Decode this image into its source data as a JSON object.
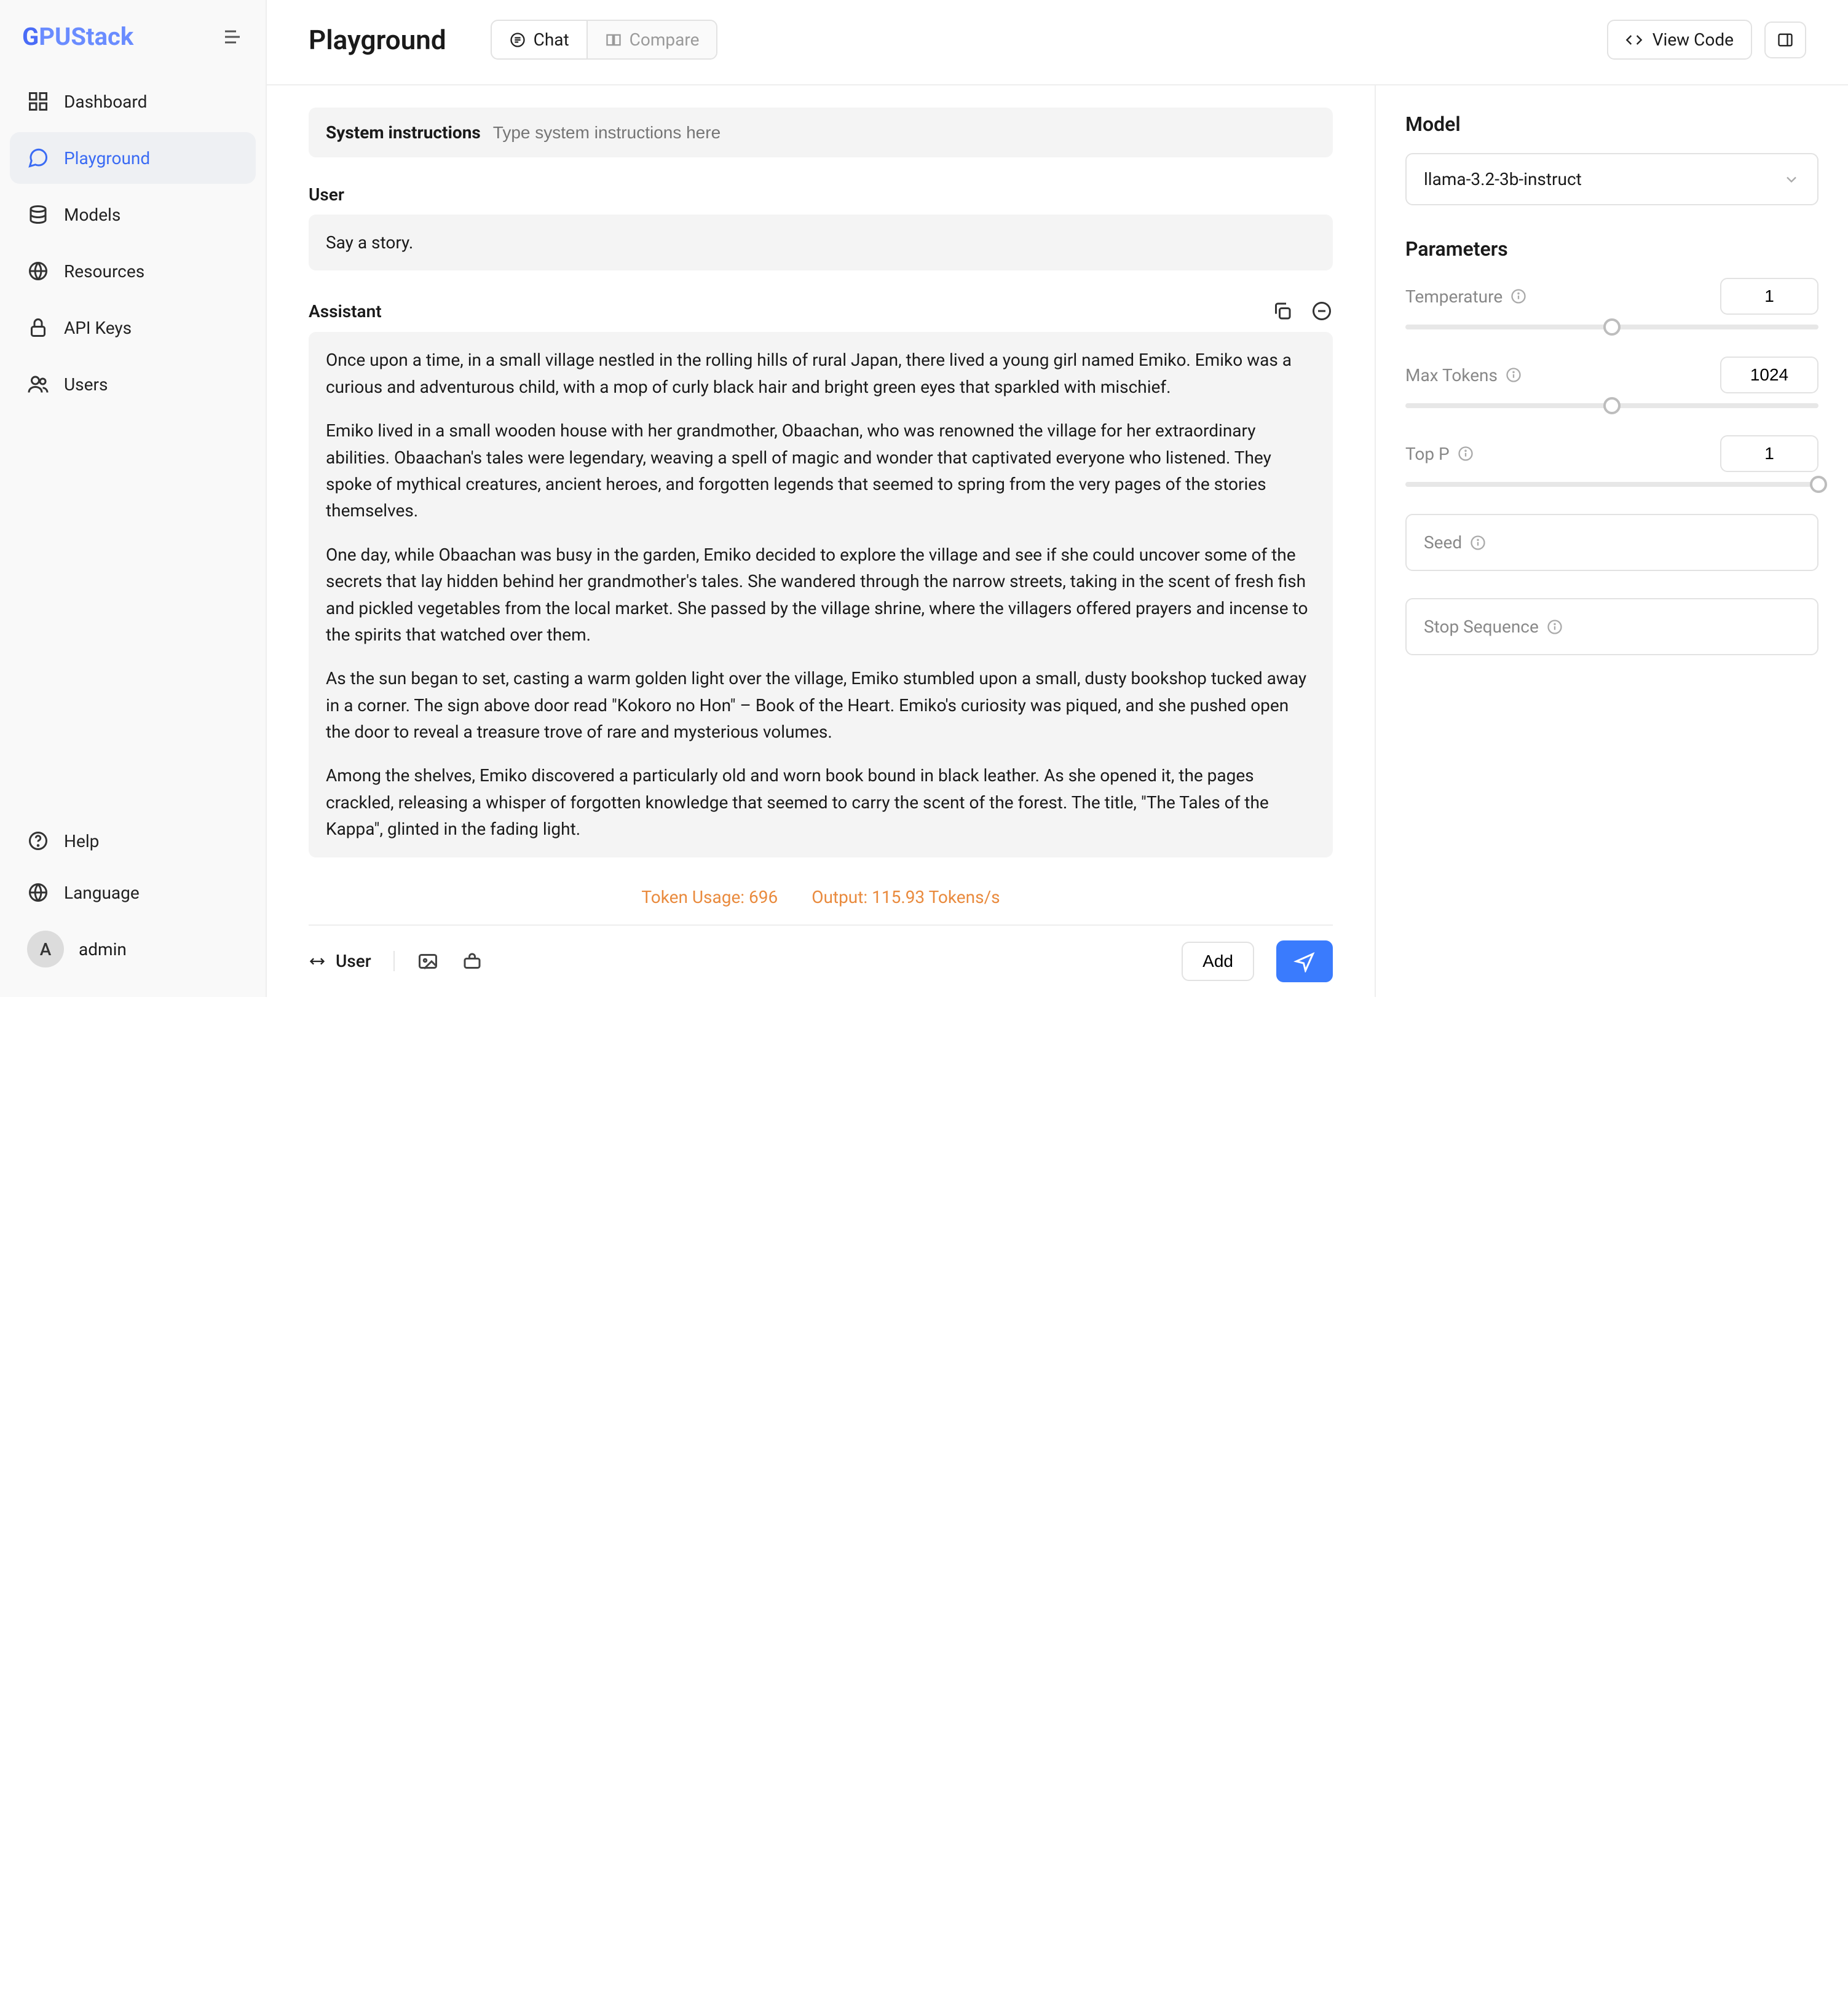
{
  "brand": {
    "g": "G",
    "rest": "PUStack"
  },
  "sidebar": {
    "items": [
      {
        "label": "Dashboard"
      },
      {
        "label": "Playground"
      },
      {
        "label": "Models"
      },
      {
        "label": "Resources"
      },
      {
        "label": "API Keys"
      },
      {
        "label": "Users"
      }
    ],
    "bottom": [
      {
        "label": "Help"
      },
      {
        "label": "Language"
      }
    ],
    "user": {
      "initial": "A",
      "name": "admin"
    }
  },
  "topbar": {
    "title": "Playground",
    "tab_chat": "Chat",
    "tab_compare": "Compare",
    "view_code": "View Code"
  },
  "system": {
    "label": "System instructions",
    "placeholder": "Type system instructions here"
  },
  "conversation": {
    "user_role": "User",
    "user_msg": "Say a story.",
    "assistant_role": "Assistant",
    "assistant_paragraphs": [
      "Once upon a time, in a small village nestled in the rolling hills of rural Japan, there lived a young girl named Emiko. Emiko was a curious and adventurous child, with a mop of curly black hair and bright green eyes that sparkled with mischief.",
      "Emiko lived in a small wooden house with her grandmother, Obaachan, who was renowned the village for her extraordinary abilities. Obaachan's tales were legendary, weaving a spell of magic and wonder that captivated everyone who listened. They spoke of mythical creatures, ancient heroes, and forgotten legends that seemed to spring from the very pages of the stories themselves.",
      "One day, while Obaachan was busy in the garden, Emiko decided to explore the village and see if she could uncover some of the secrets that lay hidden behind her grandmother's tales. She wandered through the narrow streets, taking in the scent of fresh fish and pickled vegetables from the local market. She passed by the village shrine, where the villagers offered prayers and incense to the spirits that watched over them.",
      "As the sun began to set, casting a warm golden light over the village, Emiko stumbled upon a small, dusty bookshop tucked away in a corner. The sign above door read \"Kokoro no Hon\" – Book of the Heart. Emiko's curiosity was piqued, and she pushed open the door to reveal a treasure trove of rare and mysterious volumes.",
      "Among the shelves, Emiko discovered a particularly old and worn book bound in black leather. As she opened it, the pages crackled, releasing a whisper of forgotten knowledge that seemed to carry the scent of the forest. The title, \"The Tales of the Kappa\", glinted in the fading light."
    ]
  },
  "stats": {
    "token_usage": "Token Usage: 696",
    "output": "Output: 115.93 Tokens/s"
  },
  "input_row": {
    "role": "User",
    "add": "Add"
  },
  "panel": {
    "model_section": "Model",
    "model_value": "llama-3.2-3b-instruct",
    "params_section": "Parameters",
    "temperature_label": "Temperature",
    "temperature_value": "1",
    "temperature_pct": 50,
    "max_tokens_label": "Max Tokens",
    "max_tokens_value": "1024",
    "max_tokens_pct": 50,
    "top_p_label": "Top P",
    "top_p_value": "1",
    "top_p_pct": 100,
    "seed_label": "Seed",
    "stop_label": "Stop Sequence"
  }
}
